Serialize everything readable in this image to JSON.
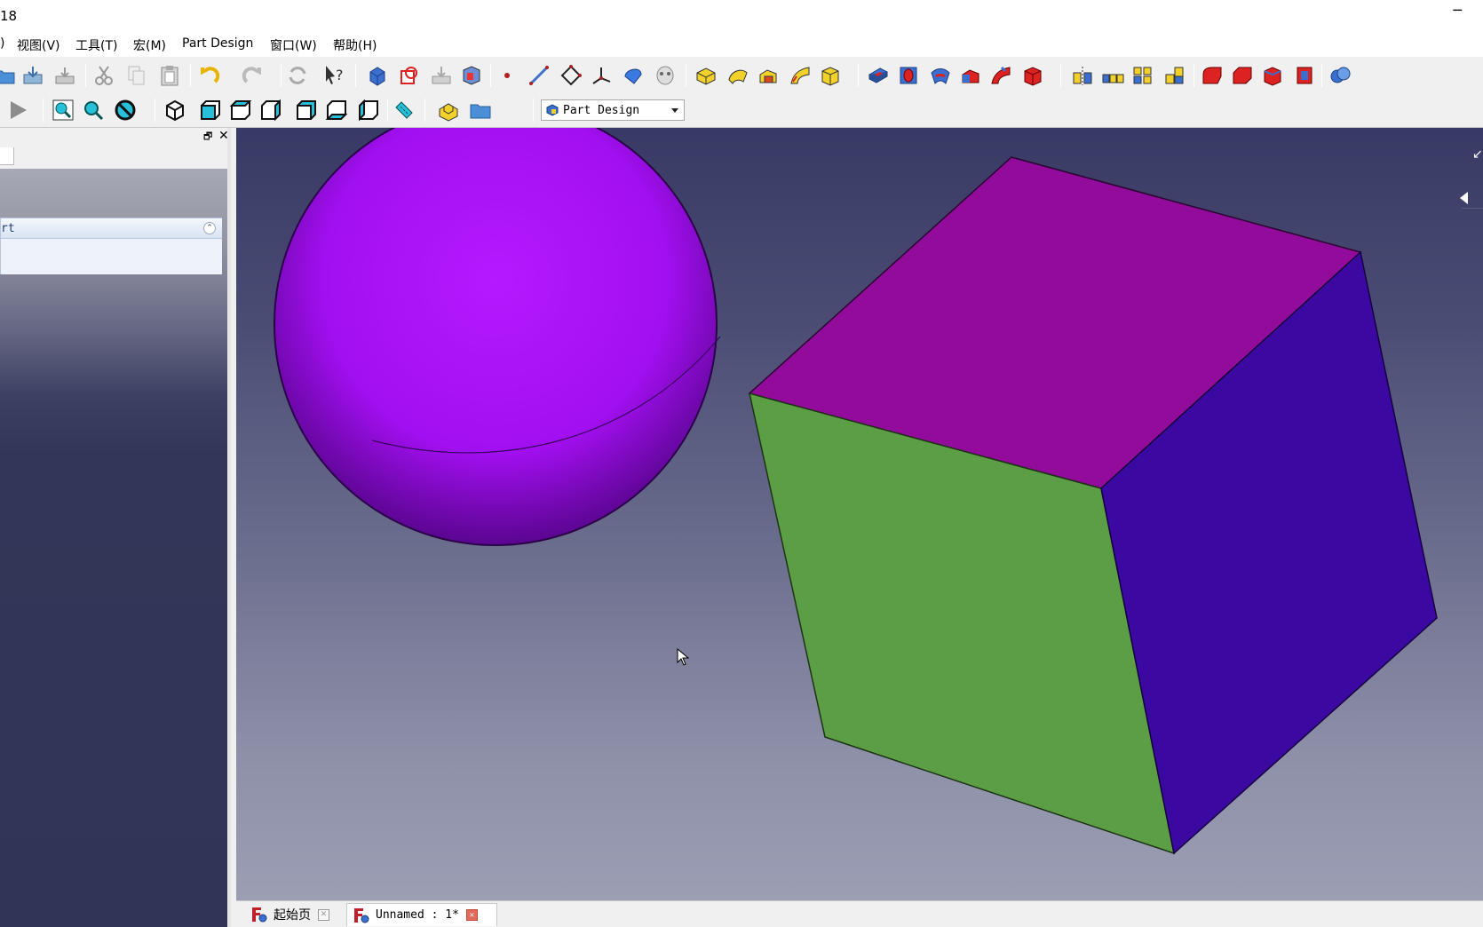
{
  "window": {
    "title": "18",
    "minimize_glyph": "─"
  },
  "menu": {
    "items": [
      {
        "label": ")"
      },
      {
        "label": "视图(V)"
      },
      {
        "label": "工具(T)"
      },
      {
        "label": "宏(M)"
      },
      {
        "label": "Part Design"
      },
      {
        "label": "窗口(W)"
      },
      {
        "label": "帮助(H)"
      }
    ]
  },
  "toolbar": {
    "workbench_selector": {
      "value": "Part Design"
    }
  },
  "combo_view": {
    "float_glyph": "🗗",
    "close_glyph": "✕",
    "task_panel": {
      "title": "rt",
      "collapse_glyph": "⌃"
    }
  },
  "viewport": {
    "background_top": "#383a65",
    "background_bottom": "#9c9eb4",
    "objects": [
      {
        "name": "sphere",
        "color": "#a20ff0"
      },
      {
        "name": "cube",
        "top_color": "#920b9a",
        "front_color": "#5c9e46",
        "side_color": "#3b08a2"
      }
    ]
  },
  "document_tabs": [
    {
      "label": "起始页",
      "active": false,
      "close_glyph": "✕"
    },
    {
      "label": "Unnamed : 1*",
      "active": true,
      "close_glyph": "✕"
    }
  ],
  "icons": {
    "open": "open-folder-icon",
    "save": "save-icon",
    "save_as": "save-as-icon",
    "cut": "cut-icon",
    "copy": "copy-icon",
    "paste": "paste-icon",
    "undo": "undo-icon",
    "redo": "redo-icon",
    "refresh": "refresh-icon",
    "whats_this": "whats-this-icon"
  }
}
